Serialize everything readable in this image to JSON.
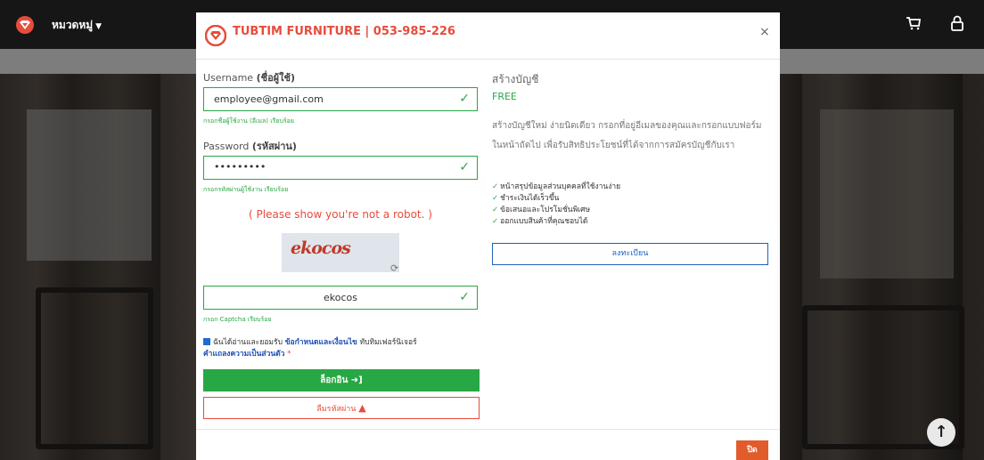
{
  "topbar": {
    "category_label": "หมวดหมู่",
    "cart_icon": "cart-icon",
    "lock_icon": "lock-icon"
  },
  "modal": {
    "title": "TUBTIM FURNITURE | 053-985-226",
    "close_symbol": "×",
    "login": {
      "username_label": "Username",
      "username_label_th": "(ชื่อผู้ใช้)",
      "username_value": "employee@gmail.com",
      "username_hint": "กรอกชื่อผู้ใช้งาน (อีเมล) เรียบร้อย",
      "password_label": "Password",
      "password_label_th": "(รหัสผ่าน)",
      "password_value": "•••••••••",
      "password_hint": "กรอกรหัสผ่านผู้ใช้งาน เรียบร้อย",
      "robot_prompt": "( Please show you're not a robot. )",
      "captcha_image_text": "ekocos",
      "captcha_value": "ekocos",
      "captcha_hint": "กรอก Captcha เรียบร้อย",
      "terms_prefix": "ฉันได้อ่านและยอมรับ",
      "terms_link": "ข้อกำหนดและเงื่อนไข",
      "terms_middle": "ทับทิมเฟอร์นิเจอร์",
      "privacy_link": "คำแถลงความเป็นส่วนตัว",
      "required_mark": "*",
      "login_button": "ล็อกอิน",
      "forgot_button": "ลืมรหัสผ่าน"
    },
    "register": {
      "title": "สร้างบัญชี",
      "free": "FREE",
      "description": "สร้างบัญชีใหม่ ง่ายนิดเดียว กรอกที่อยู่อีเมลของคุณและกรอกแบบฟอร์มในหน้าถัดไป เพื่อรับสิทธิประโยชน์ที่ได้จากการสมัครบัญชีกับเรา",
      "benefits": [
        "หน้าสรุปข้อมูลส่วนบุคคลที่ใช้งานง่าย",
        "ชำระเงินได้เร็วขึ้น",
        "ข้อเสนอและโปรโมชั่นพิเศษ",
        "ออกแบบสินค้าที่คุณชอบได้"
      ],
      "register_button": "ลงทะเบียน"
    },
    "footer_close": "ปิด"
  },
  "colors": {
    "accent": "#e74c3c",
    "success": "#28a745",
    "link": "#1f5fbf"
  }
}
